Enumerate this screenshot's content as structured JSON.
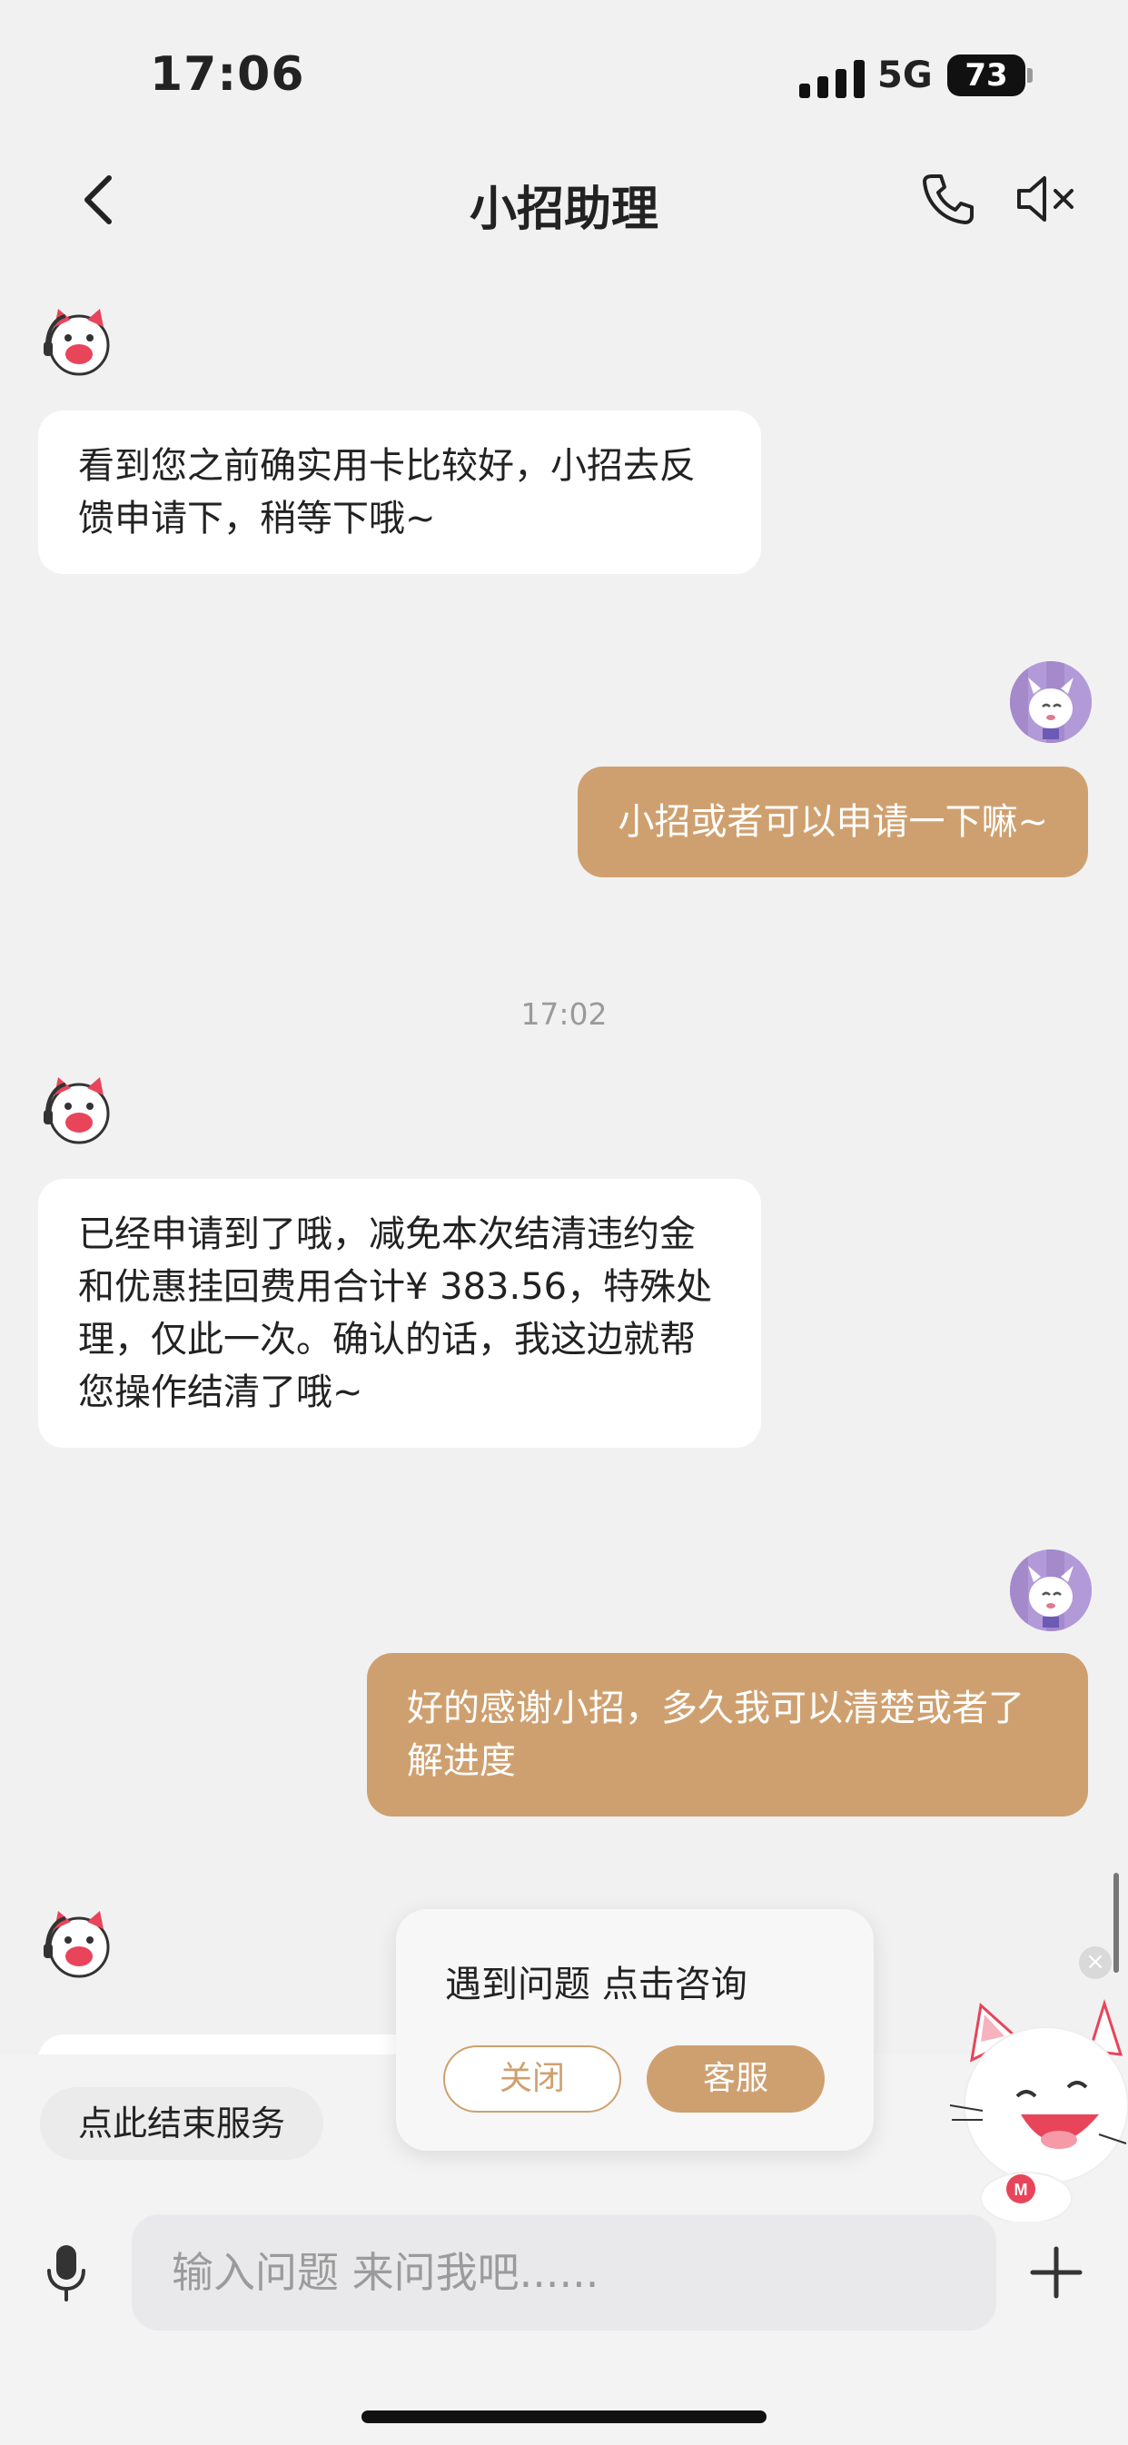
{
  "status_bar": {
    "time": "17:06",
    "network": "5G",
    "battery": "73"
  },
  "nav": {
    "title": "小招助理",
    "back_icon": "chevron-left-icon",
    "phone_icon": "phone-icon",
    "mute_icon": "speaker-mute-icon"
  },
  "chat": {
    "messages": [
      {
        "sender": "bot",
        "text": "看到您之前确实用卡比较好，小招去反馈申请下，稍等下哦~"
      },
      {
        "sender": "user",
        "text": "小招或者可以申请一下嘛~"
      },
      {
        "sender": "bot",
        "text": "已经申请到了哦，减免本次结清违约金和优惠挂回费用合计¥ 383.56，特殊处理，仅此一次。确认的话，我这边就帮您操作结清了哦~"
      },
      {
        "sender": "user",
        "text": "好的感谢小招，多久我可以清楚或者了解进度"
      }
    ],
    "timestamp": "17:02"
  },
  "popup": {
    "title": "遇到问题 点击咨询",
    "close_label": "关闭",
    "service_label": "客服"
  },
  "bottom": {
    "end_service_label": "点此结束服务",
    "input_placeholder": "输入问题 来问我吧......",
    "mic_icon": "microphone-icon",
    "plus_icon": "plus-icon"
  },
  "colors": {
    "accent": "#cfa06f",
    "background": "#f1f1f2",
    "bot_bubble": "#ffffff"
  }
}
